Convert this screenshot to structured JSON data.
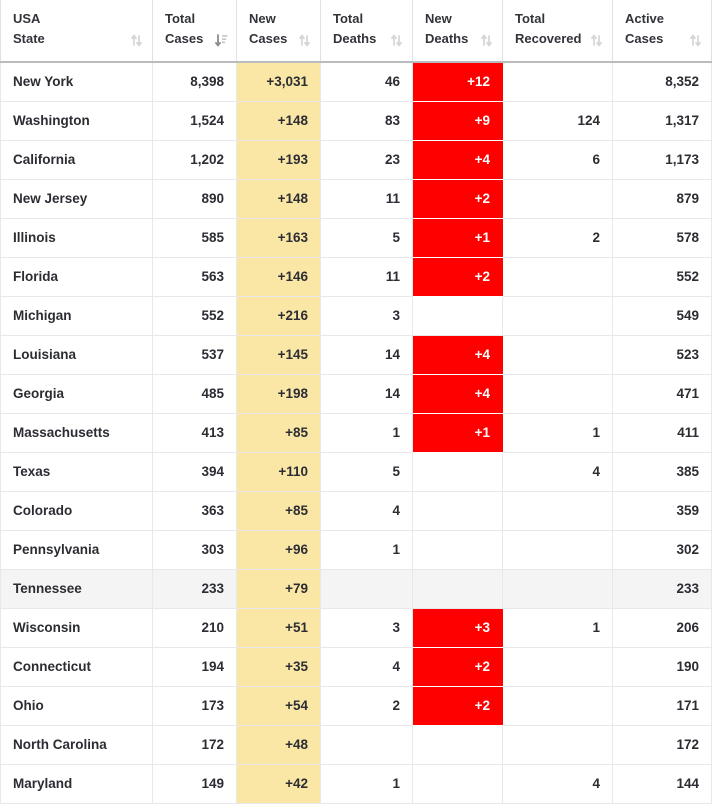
{
  "table": {
    "columns": [
      {
        "line1": "USA",
        "line2": "State",
        "sort": "sort-both-icon",
        "align": "left"
      },
      {
        "line1": "Total",
        "line2": "Cases",
        "sort": "sort-descending-icon",
        "align": "right"
      },
      {
        "line1": "New",
        "line2": "Cases",
        "sort": "sort-both-icon",
        "align": "right"
      },
      {
        "line1": "Total",
        "line2": "Deaths",
        "sort": "sort-both-icon",
        "align": "right"
      },
      {
        "line1": "New",
        "line2": "Deaths",
        "sort": "sort-both-icon",
        "align": "right"
      },
      {
        "line1": "Total",
        "line2": "Recovered",
        "sort": "sort-both-icon",
        "align": "right"
      },
      {
        "line1": "Active",
        "line2": "Cases",
        "sort": "sort-both-icon",
        "align": "right"
      }
    ],
    "colors": {
      "new_cases_highlight": "#fae7a6",
      "new_deaths_highlight": "#ff0000",
      "row_highlight": "#f4f4f5",
      "grid_line": "#e8e8ea",
      "header_rule": "#b9bbbe",
      "text": "#2b2d33"
    },
    "rows": [
      {
        "state": "New York",
        "total_cases": "8,398",
        "new_cases": "+3,031",
        "total_deaths": "46",
        "new_deaths": "+12",
        "total_recovered": "",
        "active_cases": "8,352",
        "highlight": false
      },
      {
        "state": "Washington",
        "total_cases": "1,524",
        "new_cases": "+148",
        "total_deaths": "83",
        "new_deaths": "+9",
        "total_recovered": "124",
        "active_cases": "1,317",
        "highlight": false
      },
      {
        "state": "California",
        "total_cases": "1,202",
        "new_cases": "+193",
        "total_deaths": "23",
        "new_deaths": "+4",
        "total_recovered": "6",
        "active_cases": "1,173",
        "highlight": false
      },
      {
        "state": "New Jersey",
        "total_cases": "890",
        "new_cases": "+148",
        "total_deaths": "11",
        "new_deaths": "+2",
        "total_recovered": "",
        "active_cases": "879",
        "highlight": false
      },
      {
        "state": "Illinois",
        "total_cases": "585",
        "new_cases": "+163",
        "total_deaths": "5",
        "new_deaths": "+1",
        "total_recovered": "2",
        "active_cases": "578",
        "highlight": false
      },
      {
        "state": "Florida",
        "total_cases": "563",
        "new_cases": "+146",
        "total_deaths": "11",
        "new_deaths": "+2",
        "total_recovered": "",
        "active_cases": "552",
        "highlight": false
      },
      {
        "state": "Michigan",
        "total_cases": "552",
        "new_cases": "+216",
        "total_deaths": "3",
        "new_deaths": "",
        "total_recovered": "",
        "active_cases": "549",
        "highlight": false
      },
      {
        "state": "Louisiana",
        "total_cases": "537",
        "new_cases": "+145",
        "total_deaths": "14",
        "new_deaths": "+4",
        "total_recovered": "",
        "active_cases": "523",
        "highlight": false
      },
      {
        "state": "Georgia",
        "total_cases": "485",
        "new_cases": "+198",
        "total_deaths": "14",
        "new_deaths": "+4",
        "total_recovered": "",
        "active_cases": "471",
        "highlight": false
      },
      {
        "state": "Massachusetts",
        "total_cases": "413",
        "new_cases": "+85",
        "total_deaths": "1",
        "new_deaths": "+1",
        "total_recovered": "1",
        "active_cases": "411",
        "highlight": false
      },
      {
        "state": "Texas",
        "total_cases": "394",
        "new_cases": "+110",
        "total_deaths": "5",
        "new_deaths": "",
        "total_recovered": "4",
        "active_cases": "385",
        "highlight": false
      },
      {
        "state": "Colorado",
        "total_cases": "363",
        "new_cases": "+85",
        "total_deaths": "4",
        "new_deaths": "",
        "total_recovered": "",
        "active_cases": "359",
        "highlight": false
      },
      {
        "state": "Pennsylvania",
        "total_cases": "303",
        "new_cases": "+96",
        "total_deaths": "1",
        "new_deaths": "",
        "total_recovered": "",
        "active_cases": "302",
        "highlight": false
      },
      {
        "state": "Tennessee",
        "total_cases": "233",
        "new_cases": "+79",
        "total_deaths": "",
        "new_deaths": "",
        "total_recovered": "",
        "active_cases": "233",
        "highlight": true
      },
      {
        "state": "Wisconsin",
        "total_cases": "210",
        "new_cases": "+51",
        "total_deaths": "3",
        "new_deaths": "+3",
        "total_recovered": "1",
        "active_cases": "206",
        "highlight": false
      },
      {
        "state": "Connecticut",
        "total_cases": "194",
        "new_cases": "+35",
        "total_deaths": "4",
        "new_deaths": "+2",
        "total_recovered": "",
        "active_cases": "190",
        "highlight": false
      },
      {
        "state": "Ohio",
        "total_cases": "173",
        "new_cases": "+54",
        "total_deaths": "2",
        "new_deaths": "+2",
        "total_recovered": "",
        "active_cases": "171",
        "highlight": false
      },
      {
        "state": "North Carolina",
        "total_cases": "172",
        "new_cases": "+48",
        "total_deaths": "",
        "new_deaths": "",
        "total_recovered": "",
        "active_cases": "172",
        "highlight": false
      },
      {
        "state": "Maryland",
        "total_cases": "149",
        "new_cases": "+42",
        "total_deaths": "1",
        "new_deaths": "",
        "total_recovered": "4",
        "active_cases": "144",
        "highlight": false
      }
    ],
    "partial_row": {
      "state": "",
      "total_cases": "",
      "new_cases": "",
      "total_deaths": "",
      "new_deaths": " ",
      "total_recovered": "",
      "active_cases": ""
    }
  }
}
